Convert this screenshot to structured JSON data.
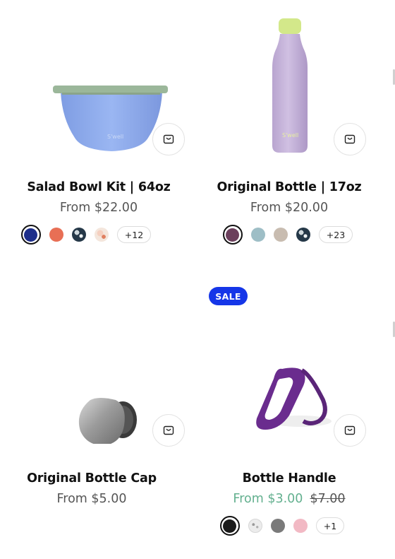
{
  "products": [
    {
      "title": "Salad Bowl Kit | 64oz",
      "price": "From $22.00",
      "swatches": [
        "#1d2e8a",
        "#e86f55",
        "speckle-dark",
        "speckle-peach"
      ],
      "more": "+12",
      "image": "salad-bowl"
    },
    {
      "title": "Original Bottle | 17oz",
      "price": "From $20.00",
      "swatches": [
        "#6b3f5c",
        "#9ebec6",
        "#c8bcb0",
        "speckle-dark"
      ],
      "more": "+23",
      "image": "bottle"
    },
    {
      "title": "Original Bottle Cap",
      "price": "From $5.00",
      "image": "bottle-cap"
    },
    {
      "title": "Bottle Handle",
      "sale_price": "From $3.00",
      "original_price": "$7.00",
      "swatches": [
        "#1a1a1a",
        "speckle-light",
        "#7a7a7a",
        "#f2b9c4"
      ],
      "more": "+1",
      "image": "handle"
    }
  ],
  "badge": {
    "label": "SALE",
    "color": "#1536e8"
  },
  "colors": {
    "sale_price": "#63b08f",
    "text": "#111111",
    "muted": "#555555"
  }
}
